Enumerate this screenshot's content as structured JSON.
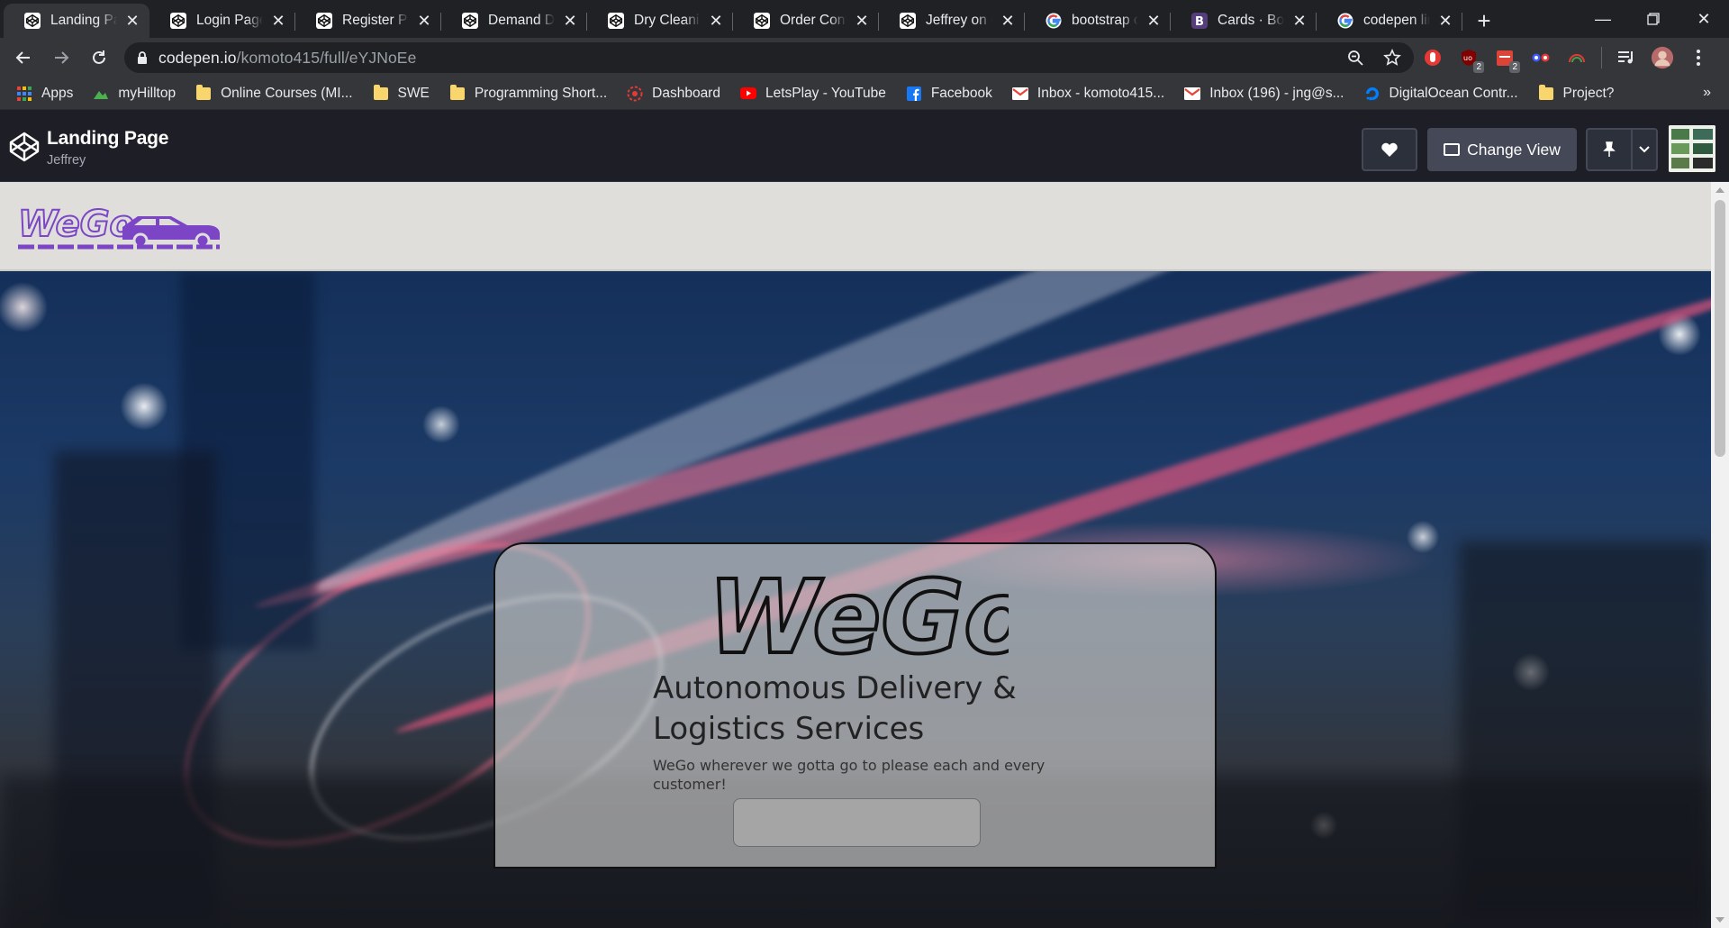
{
  "browser": {
    "tabs": [
      {
        "title": "Landing Page",
        "icon": "codepen-icon",
        "active": true
      },
      {
        "title": "Login Page",
        "icon": "codepen-icon"
      },
      {
        "title": "Register Page",
        "icon": "codepen-icon"
      },
      {
        "title": "Demand Dashboard",
        "icon": "codepen-icon"
      },
      {
        "title": "Dry Cleaning",
        "icon": "codepen-icon"
      },
      {
        "title": "Order Confirmation",
        "icon": "codepen-icon"
      },
      {
        "title": "Jeffrey on CodePen",
        "icon": "codepen-icon"
      },
      {
        "title": "bootstrap cards",
        "icon": "google-icon"
      },
      {
        "title": "Cards · Bootstrap",
        "icon": "bootstrap-icon"
      },
      {
        "title": "codepen link",
        "icon": "google-icon"
      }
    ],
    "url_host": "codepen.io",
    "url_path": "/komoto415/full/eYJNoEe",
    "bookmarks": [
      {
        "label": "Apps",
        "icon": "apps-grid-icon"
      },
      {
        "label": "myHilltop",
        "icon": "hilltop-icon"
      },
      {
        "label": "Online Courses (MI...",
        "icon": "folder-icon"
      },
      {
        "label": "SWE",
        "icon": "folder-icon"
      },
      {
        "label": "Programming Short...",
        "icon": "folder-icon"
      },
      {
        "label": "Dashboard",
        "icon": "dashboard-icon"
      },
      {
        "label": "LetsPlay - YouTube",
        "icon": "youtube-icon"
      },
      {
        "label": "Facebook",
        "icon": "facebook-icon"
      },
      {
        "label": "Inbox - komoto415...",
        "icon": "gmail-icon"
      },
      {
        "label": "Inbox (196) - jng@s...",
        "icon": "gmail-icon"
      },
      {
        "label": "DigitalOcean Contr...",
        "icon": "digitalocean-icon"
      },
      {
        "label": "Project?",
        "icon": "folder-icon"
      }
    ],
    "bookmarks_more": "»",
    "extension_badges": [
      "2",
      "2"
    ]
  },
  "codepen": {
    "pen_title": "Landing Page",
    "author": "Jeffrey",
    "change_view_label": "Change View"
  },
  "site": {
    "logo_text": "WeGo",
    "hero": {
      "wordmark": "WeGo",
      "heading": "Autonomous Delivery & Logistics Services",
      "tagline": "WeGo wherever we gotta go to please each and every customer!",
      "button_label": ""
    }
  },
  "colors": {
    "chrome_dark": "#202124",
    "chrome_toolbar": "#35363a",
    "codepen_header": "#1e1f26",
    "site_nav_bg": "#dfdedb",
    "logo_purple": "#7b45c6",
    "card_bg": "rgba(200,200,200,0.68)"
  }
}
